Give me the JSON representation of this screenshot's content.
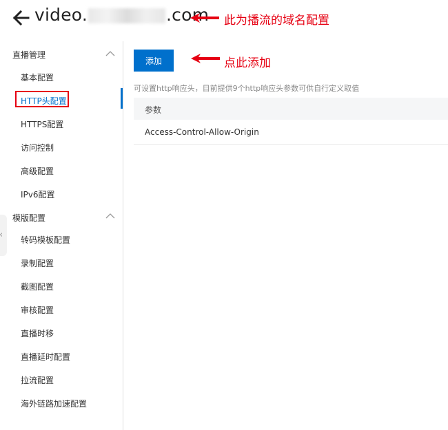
{
  "header": {
    "domain_prefix": "video.",
    "domain_suffix": ".com",
    "annotation": "此为播流的域名配置"
  },
  "sidebar": {
    "groups": [
      {
        "title": "直播管理",
        "items": [
          "基本配置",
          "HTTP头配置",
          "HTTPS配置",
          "访问控制",
          "高级配置",
          "IPv6配置"
        ]
      },
      {
        "title": "模版配置",
        "items": [
          "转码模板配置",
          "录制配置",
          "截图配置",
          "审核配置",
          "直播时移",
          "直播延时配置",
          "拉流配置",
          "海外链路加速配置"
        ]
      }
    ],
    "active_item": "HTTP头配置"
  },
  "main": {
    "add_button": "添加",
    "add_annotation": "点此添加",
    "hint": "可设置http响应头，目前提供9个http响应头参数可供自行定义取值",
    "table": {
      "header": "参数",
      "rows": [
        "Access-Control-Allow-Origin"
      ]
    }
  },
  "colors": {
    "accent": "#0070cc",
    "annotation": "#e60012"
  }
}
